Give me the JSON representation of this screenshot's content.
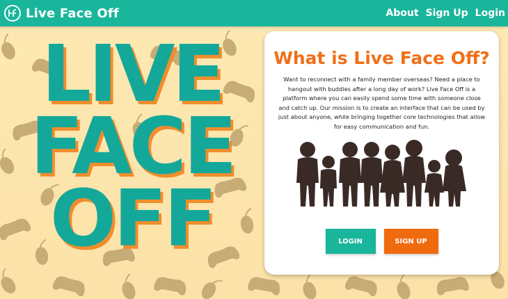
{
  "nav": {
    "brand": "Live Face Off",
    "links": [
      {
        "label": "About"
      },
      {
        "label": "Sign Up"
      },
      {
        "label": "Login"
      }
    ]
  },
  "hero": {
    "lines": [
      "LIVE",
      "FACE",
      "OFF"
    ]
  },
  "card": {
    "title": "What is Live Face Off?",
    "description": "Want to reconnect with a family member overseas? Need a place to hangout with buddies after a long day of work? Live Face Off is a platform where you can easily spend some time with someone close and catch up. Our mission is to create an interface that can be used by just about anyone, while bringing together core technologies that allow for easy communication and fun.",
    "login_label": "LOGIN",
    "signup_label": "SIGN UP"
  },
  "colors": {
    "teal": "#1ab69c",
    "orange": "#f07018",
    "background": "#fde9b4",
    "pattern": "#c9b07a"
  }
}
